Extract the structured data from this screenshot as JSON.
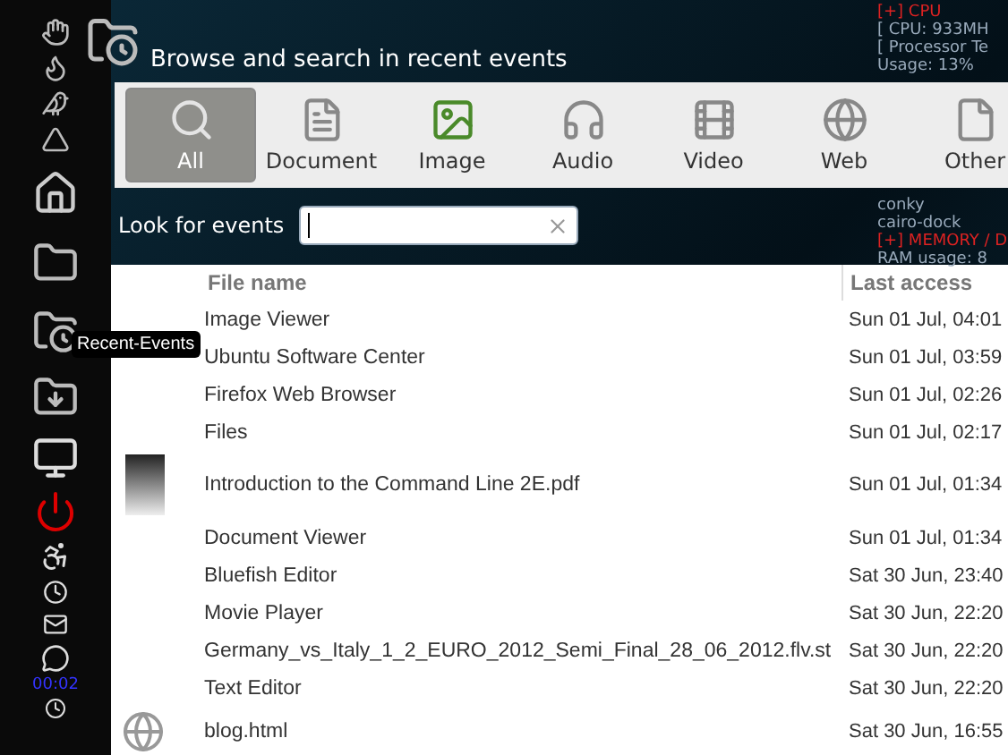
{
  "window": {
    "title": "Browse and search in recent events"
  },
  "filters": [
    {
      "label": "All",
      "kind": "all",
      "selected": true
    },
    {
      "label": "Document",
      "kind": "document",
      "selected": false
    },
    {
      "label": "Image",
      "kind": "image",
      "selected": false
    },
    {
      "label": "Audio",
      "kind": "audio",
      "selected": false
    },
    {
      "label": "Video",
      "kind": "video",
      "selected": false
    },
    {
      "label": "Web",
      "kind": "web",
      "selected": false
    },
    {
      "label": "Other",
      "kind": "other",
      "selected": false
    }
  ],
  "search": {
    "label": "Look for events"
  },
  "table": {
    "columns": [
      "File name",
      "Last access"
    ],
    "rows": [
      {
        "name": "Image Viewer",
        "time": "Sun 01 Jul, 04:01",
        "kind": "app"
      },
      {
        "name": "Ubuntu Software Center",
        "time": "Sun 01 Jul, 03:59",
        "kind": "app"
      },
      {
        "name": "Firefox Web Browser",
        "time": "Sun 01 Jul, 02:26",
        "kind": "app"
      },
      {
        "name": "Files",
        "time": "Sun 01 Jul, 02:17",
        "kind": "app"
      },
      {
        "name": "Introduction to the Command Line 2E.pdf",
        "time": "Sun 01 Jul, 01:34",
        "kind": "document"
      },
      {
        "name": "Document Viewer",
        "time": "Sun 01 Jul, 01:34",
        "kind": "app"
      },
      {
        "name": "Bluefish Editor",
        "time": "Sat 30 Jun, 23:40",
        "kind": "app"
      },
      {
        "name": "Movie Player",
        "time": "Sat 30 Jun, 22:20",
        "kind": "app"
      },
      {
        "name": "Germany_vs_Italy_1_2_EURO_2012_Semi_Final_28_06_2012.flv.st",
        "time": "Sat 30 Jun, 22:20",
        "kind": "app"
      },
      {
        "name": "Text Editor",
        "time": "Sat 30 Jun, 22:20",
        "kind": "app"
      },
      {
        "name": "blog.html",
        "time": "Sat 30 Jun, 16:55",
        "kind": "web"
      }
    ]
  },
  "dock": {
    "tooltip": "Recent-Events",
    "clock": "00:02"
  },
  "conky": {
    "top": [
      "[+] CPU",
      "[ CPU: 933MH",
      "[ Processor Te",
      "Usage: 13%"
    ],
    "middle": [
      "conky",
      "cairo-dock"
    ],
    "bottom": [
      "[+] MEMORY / D",
      "RAM usage: 8"
    ]
  }
}
